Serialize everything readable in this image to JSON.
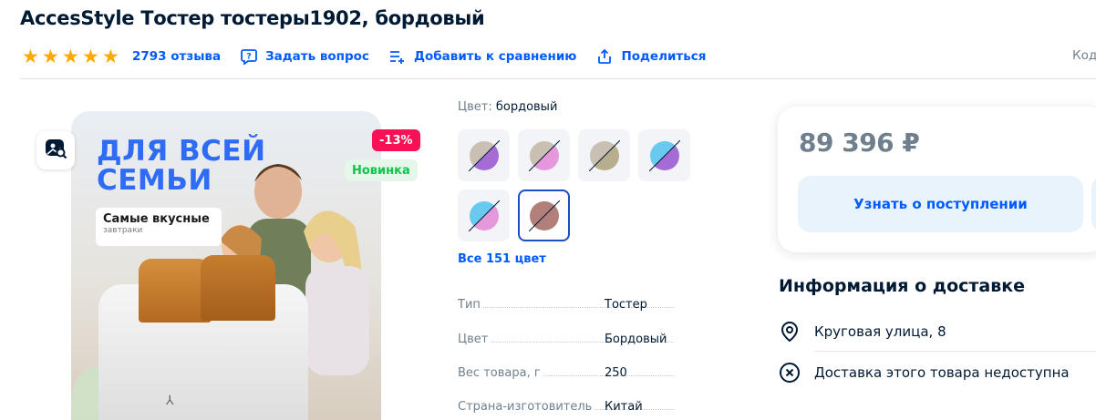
{
  "product": {
    "title": "AccesStyle Тостер тостеры1902, бордовый"
  },
  "rating": {
    "stars": 5,
    "reviews_label": "2793 отзыва"
  },
  "actions": {
    "ask_label": "Задать вопрос",
    "compare_label": "Добавить к сравнению",
    "share_label": "Поделиться"
  },
  "code_label": "Код",
  "image": {
    "promo_line1": "ДЛЯ ВСЕЙ",
    "promo_line2": "СЕМЬИ",
    "promo_card_title": "Самые вкусные",
    "promo_card_subtitle": "завтраки",
    "badge_discount": "-13%",
    "badge_new": "Новинка"
  },
  "color": {
    "label": "Цвет:",
    "value": "бордовый",
    "swatches": [
      {
        "left": "#c9bfb3",
        "right": "#a56cd6"
      },
      {
        "left": "#c9bfb3",
        "right": "#e598dc"
      },
      {
        "left": "#c9bfb3",
        "right": "#b8ae8e"
      },
      {
        "left": "#6ac9ef",
        "right": "#a56cd6"
      },
      {
        "left": "#6ac9ef",
        "right": "#e598dc"
      },
      {
        "left": "#b27f7a",
        "right": "#b27f7a"
      }
    ],
    "all_colors_label": "Все 151 цвет"
  },
  "specs": [
    {
      "key": "Тип",
      "value": "Тостер"
    },
    {
      "key": "Цвет",
      "value": "Бордовый"
    },
    {
      "key": "Вес товара, г",
      "value": "250"
    },
    {
      "key": "Страна-изготовитель",
      "value": "Китай"
    }
  ],
  "purchase": {
    "price": "89 396 ₽",
    "notify_label": "Узнать о поступлении"
  },
  "delivery": {
    "title": "Информация о доставке",
    "address": "Круговая улица, 8",
    "status": "Доставка этого товара недоступна"
  },
  "colors": {
    "accent": "#005bff",
    "star": "#ffa800",
    "discount": "#f91155",
    "new": "#10c44c"
  }
}
